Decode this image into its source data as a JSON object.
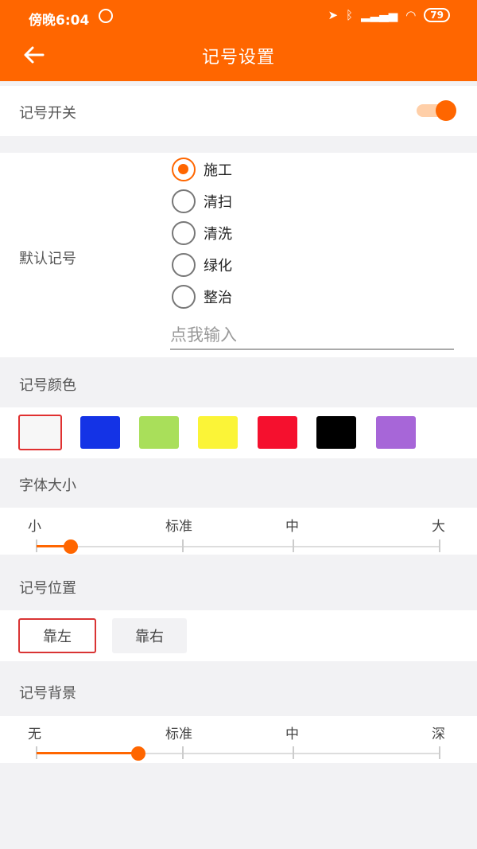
{
  "status_bar": {
    "time": "傍晚6:04",
    "battery": "79"
  },
  "header": {
    "title": "记号设置",
    "back_icon": "arrow-left-icon"
  },
  "mark_switch": {
    "label": "记号开关",
    "enabled": true,
    "accent": "#ff6600"
  },
  "default_mark": {
    "label": "默认记号",
    "options": [
      "施工",
      "清扫",
      "清洗",
      "绿化",
      "整治"
    ],
    "selected": "施工",
    "input_placeholder": "点我输入",
    "input_value": ""
  },
  "mark_color": {
    "label": "记号颜色",
    "colors": [
      "#f7f7f7",
      "#1433e6",
      "#a9df5a",
      "#fbf437",
      "#f5102e",
      "#000000",
      "#a766d8"
    ],
    "selected_index": 0
  },
  "font_size": {
    "label": "字体大小",
    "ticks": [
      "小",
      "标准",
      "中",
      "大"
    ],
    "value_fraction": 0.085
  },
  "mark_position": {
    "label": "记号位置",
    "options": [
      "靠左",
      "靠右"
    ],
    "selected": "靠左"
  },
  "mark_background": {
    "label": "记号背景",
    "ticks": [
      "无",
      "标准",
      "中",
      "深"
    ],
    "value_fraction": 0.25
  }
}
